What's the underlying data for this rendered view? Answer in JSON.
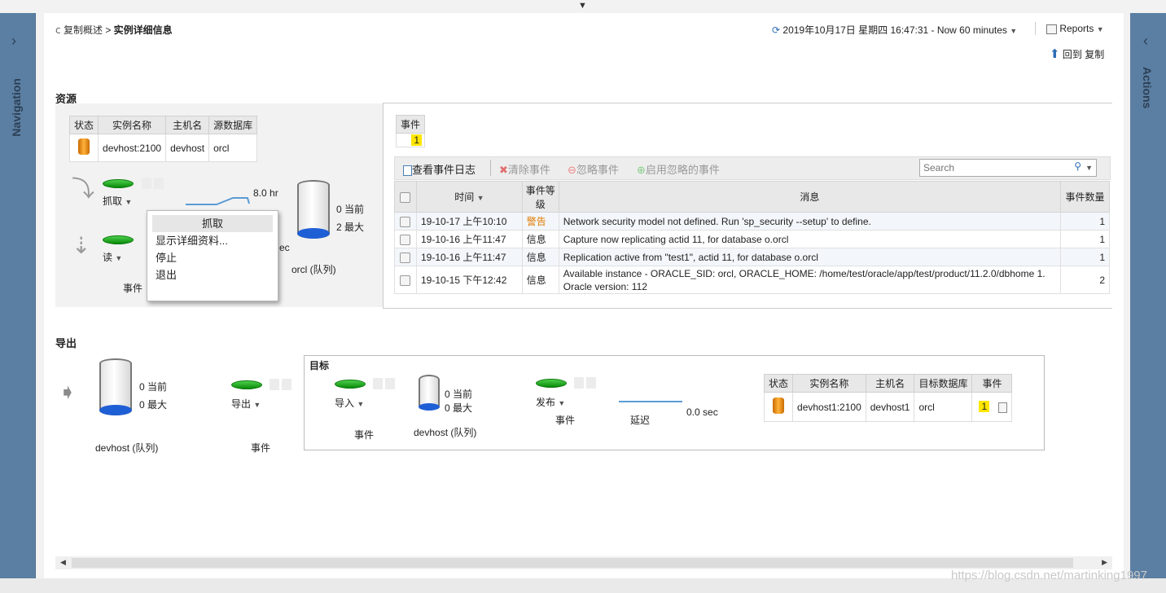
{
  "breadcrumb": {
    "parent": "复制概述",
    "sep": ">",
    "current": "实例详细信息"
  },
  "timebar": {
    "datetime": "2019年10月17日 星期四 16:47:31 - Now 60 minutes",
    "reports": "Reports",
    "back": "回到 复制"
  },
  "sidebars": {
    "left": "Navigation",
    "right": "Actions"
  },
  "resources": {
    "title": "资源",
    "table": {
      "headers": [
        "状态",
        "实例名称",
        "主机名",
        "源数据库"
      ],
      "row": [
        "devhost:2100",
        "devhost",
        "orcl"
      ]
    },
    "capture_label": "抓取",
    "read_label": "读",
    "events_label": "事件",
    "latency": "8.0 hr",
    "queue": {
      "current": "0 当前",
      "max": "2 最大",
      "name": "orcl (队列)",
      "partial": "ec"
    }
  },
  "context_menu": {
    "items": [
      "抓取",
      "显示详细资料...",
      "停止",
      "退出"
    ]
  },
  "events": {
    "mini_header": "事件",
    "mini_count": "1",
    "toolbar": {
      "view_log": "查看事件日志",
      "clear": "清除事件",
      "ignore": "忽略事件",
      "enable_ignored": "启用忽略的事件",
      "search_placeholder": "Search"
    },
    "headers": {
      "time": "时间",
      "level": "事件等级",
      "message": "消息",
      "count": "事件数量"
    },
    "rows": [
      {
        "time": "19-10-17 上午10:10",
        "level": "警告",
        "message": "Network security model not defined. Run 'sp_security --setup' to define.",
        "count": "1"
      },
      {
        "time": "19-10-16 上午11:47",
        "level": "信息",
        "message": "Capture now replicating actid 11, for database o.orcl",
        "count": "1"
      },
      {
        "time": "19-10-16 上午11:47",
        "level": "信息",
        "message": "Replication active from \"test1\", actid 11, for database o.orcl",
        "count": "1"
      },
      {
        "time": "19-10-15 下午12:42",
        "level": "信息",
        "message": "Available instance - ORACLE_SID: orcl, ORACLE_HOME: /home/test/oracle/app/test/product/11.2.0/dbhome  1. Oracle version: 112",
        "count": "2"
      }
    ]
  },
  "export": {
    "title": "导出",
    "queue": {
      "current": "0 当前",
      "max": "0 最大",
      "name": "devhost (队列)"
    },
    "export_label": "导出",
    "events_label": "事件"
  },
  "target": {
    "title": "目标",
    "import_label": "导入",
    "events_label1": "事件",
    "queue": {
      "current": "0 当前",
      "max": "0 最大",
      "name": "devhost (队列)"
    },
    "publish_label": "发布",
    "events_label2": "事件",
    "latency_label": "延迟",
    "latency": "0.0 sec",
    "table": {
      "headers": [
        "状态",
        "实例名称",
        "主机名",
        "目标数据库",
        "事件"
      ],
      "row": [
        "devhost1:2100",
        "devhost1",
        "orcl"
      ],
      "event_count": "1"
    }
  },
  "watermark": "https://blog.csdn.net/martinking1997",
  "colors": {
    "sidebar": "#5b7fa2",
    "warning": "#e07b00",
    "highlight": "#ffe600",
    "link_blue": "#2f6db5"
  }
}
